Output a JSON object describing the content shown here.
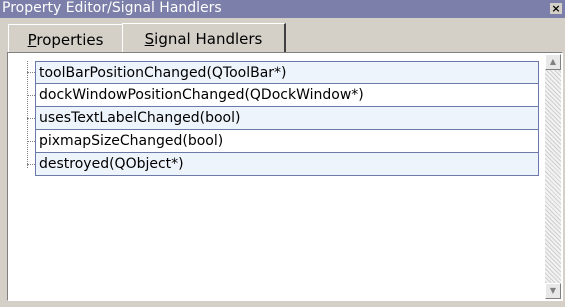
{
  "window": {
    "title": "Property Editor/Signal Handlers",
    "close_glyph": "×"
  },
  "tabs": [
    {
      "label_prefix": "",
      "accel": "P",
      "label_rest": "roperties",
      "selected": false
    },
    {
      "label_prefix": "",
      "accel": "S",
      "label_rest": "ignal Handlers",
      "selected": true
    }
  ],
  "signals": [
    {
      "label": "toolBarPositionChanged(QToolBar*)"
    },
    {
      "label": "dockWindowPositionChanged(QDockWindow*)"
    },
    {
      "label": "usesTextLabelChanged(bool)"
    },
    {
      "label": "pixmapSizeChanged(bool)"
    },
    {
      "label": "destroyed(QObject*)"
    }
  ],
  "scrollbar": {
    "up_icon": "scroll-up-arrow",
    "down_icon": "scroll-down-arrow"
  }
}
